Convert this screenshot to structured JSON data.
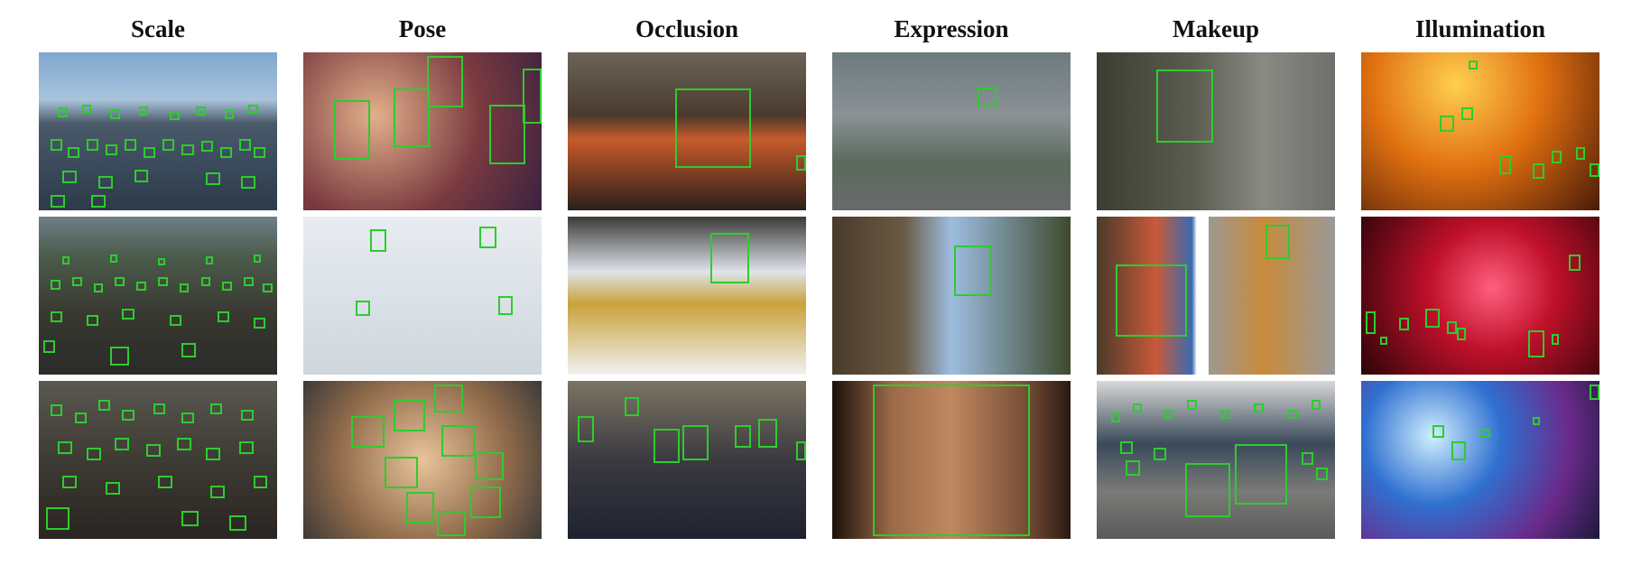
{
  "columns": [
    {
      "title": "Scale"
    },
    {
      "title": "Pose"
    },
    {
      "title": "Occlusion"
    },
    {
      "title": "Expression"
    },
    {
      "title": "Makeup"
    },
    {
      "title": "Illumination"
    }
  ],
  "colors": {
    "face_box": "#2ecc2e",
    "background": "#ffffff",
    "title": "#111111"
  }
}
